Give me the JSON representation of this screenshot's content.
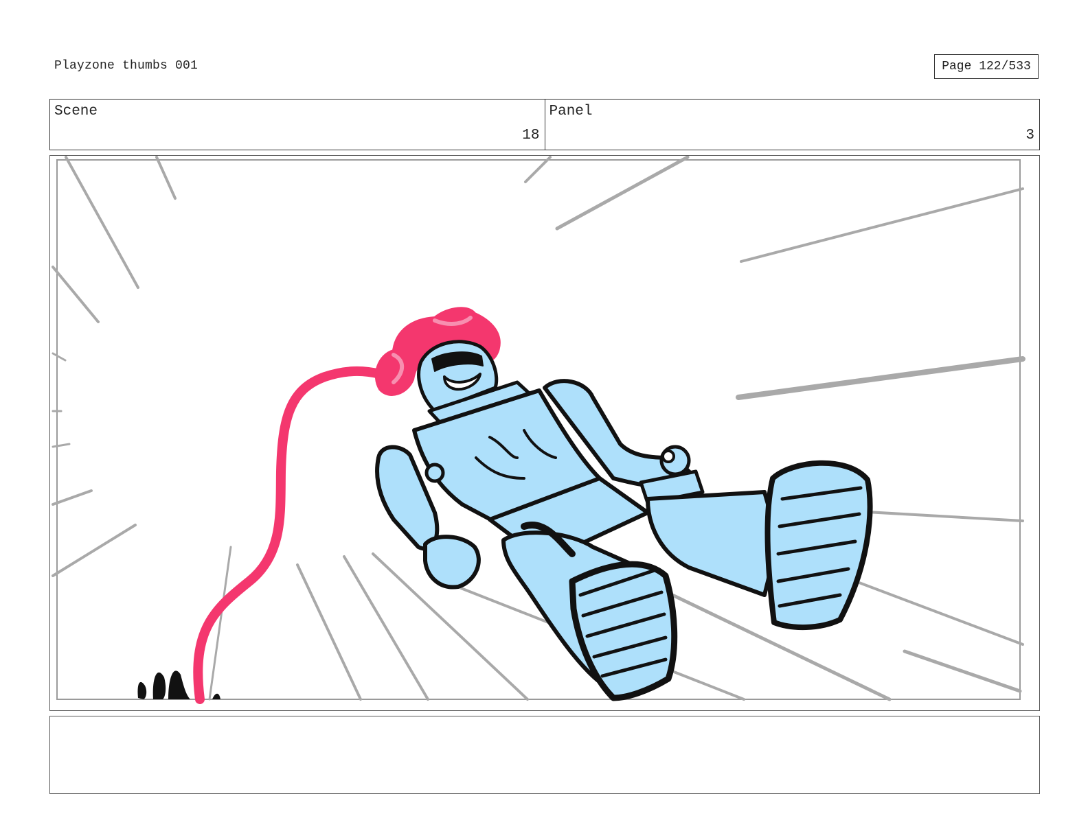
{
  "document": {
    "title": "Playzone thumbs 001",
    "page_label": "Page 122/533"
  },
  "header": {
    "scene_label": "Scene",
    "scene_value": "18",
    "panel_label": "Panel",
    "panel_value": "3"
  },
  "artwork": {
    "description_colors": {
      "speed_lines": "#a9a9a9",
      "robot_fill": "#aee0fb",
      "hair_and_cable": "#f4376e",
      "ink": "#111111"
    }
  },
  "notes": {
    "text": ""
  }
}
